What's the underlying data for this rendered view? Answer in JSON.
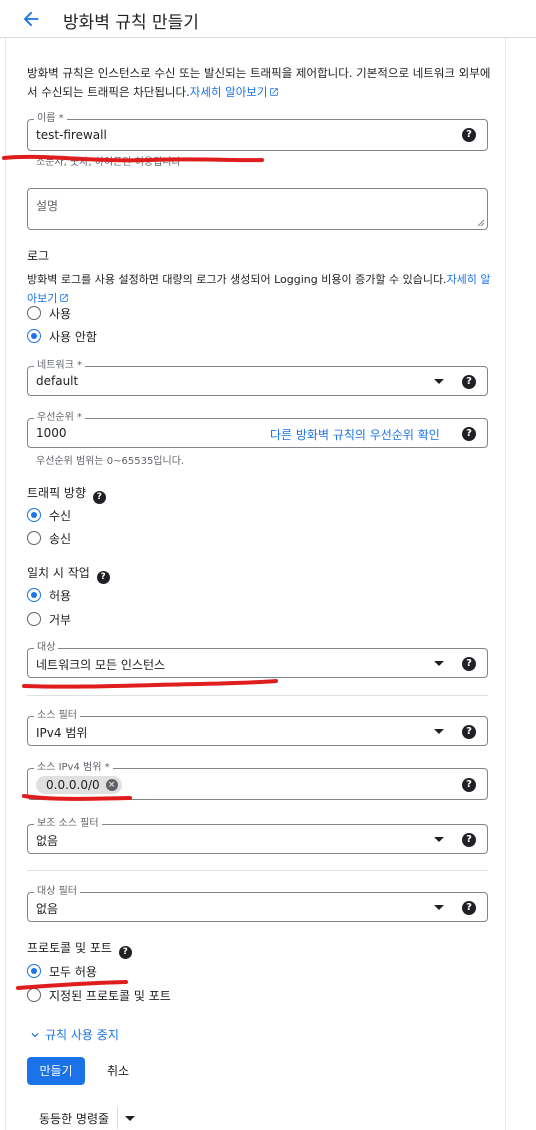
{
  "header": {
    "title": "방화벽 규칙 만들기"
  },
  "intro": {
    "text": "방화벽 규칙은 인스턴스로 수신 또는 발신되는 트래픽을 제어합니다. 기본적으로 네트워크 외부에서 수신되는 트래픽은 차단됩니다.",
    "link": "자세히 알아보기"
  },
  "name_field": {
    "label": "이름 *",
    "value": "test-firewall",
    "hint": "소문자, 숫자, 하이픈만 허용됩니다"
  },
  "description_field": {
    "placeholder": "설명"
  },
  "logs": {
    "title": "로그",
    "text": "방화벽 로그를 사용 설정하면 대량의 로그가 생성되어 Logging 비용이 증가할 수 있습니다.",
    "link": "자세히 알아보기",
    "options": [
      "사용",
      "사용 안함"
    ],
    "selected": "사용 안함"
  },
  "network_field": {
    "label": "네트워크 *",
    "value": "default"
  },
  "priority_field": {
    "label": "우선순위 *",
    "value": "1000",
    "link": "다른 방화벽 규칙의 우선순위 확인",
    "hint": "우선순위 범위는 0~65535입니다."
  },
  "direction": {
    "title": "트래픽 방향",
    "options": [
      "수신",
      "송신"
    ],
    "selected": "수신"
  },
  "action": {
    "title": "일치 시 작업",
    "options": [
      "허용",
      "거부"
    ],
    "selected": "허용"
  },
  "targets_field": {
    "label": "대상",
    "value": "네트워크의 모든 인스턴스"
  },
  "source_filter_field": {
    "label": "소스 필터",
    "value": "IPv4 범위"
  },
  "source_ranges_field": {
    "label": "소스 IPv4 범위 *",
    "chip": "0.0.0.0/0"
  },
  "secondary_source_field": {
    "label": "보조 소스 필터",
    "value": "없음"
  },
  "dest_filter_field": {
    "label": "대상 필터",
    "value": "없음"
  },
  "protocols": {
    "title": "프로토콜 및 포트",
    "options": [
      "모두 허용",
      "지정된 프로토콜 및 포트"
    ],
    "selected": "모두 허용"
  },
  "disable_rule": {
    "label": "규칙 사용 중지"
  },
  "actions": {
    "create": "만들기",
    "cancel": "취소",
    "equivalent": "동등한 명령줄"
  },
  "colors": {
    "accent": "#1a73e8",
    "annotation": "#e01d1d"
  },
  "icons": {
    "back": "arrow-left-icon",
    "help": "help-circle-icon",
    "external": "open-in-new-icon",
    "dropdown": "caret-down-icon",
    "chip_remove": "cancel-circle-icon",
    "expand": "chevron-down-icon"
  }
}
